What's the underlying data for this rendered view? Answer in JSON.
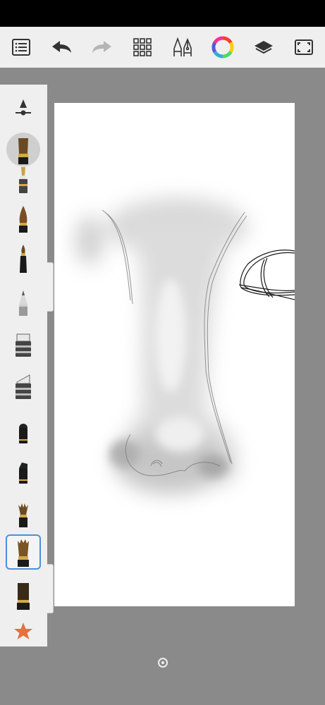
{
  "app": {
    "name": ""
  },
  "toolbar": {
    "items": [
      {
        "name": "list-icon"
      },
      {
        "name": "undo-icon"
      },
      {
        "name": "redo-icon",
        "disabled": true
      },
      {
        "name": "grid-icon"
      },
      {
        "name": "pen-tools-icon"
      },
      {
        "name": "color-wheel-icon"
      },
      {
        "name": "layers-icon"
      },
      {
        "name": "fullscreen-icon"
      }
    ]
  },
  "brush_panel": {
    "top_control": "brush-size-slider-icon",
    "brushes": [
      "bristle-brush-recent",
      "ink-pen",
      "round-brush",
      "paint-brush",
      "pencil",
      "marker-wide",
      "marker-chisel",
      "felt-marker",
      "felt-marker-dark",
      "fan-brush",
      "bristle-brush",
      "flat-brush"
    ],
    "selected": "bristle-brush",
    "favorite": "star-icon"
  },
  "colors": {
    "toolbar_bg": "#efefef",
    "canvas_bg": "#8a8a8a",
    "paper": "#ffffff",
    "selection": "#4a90d9",
    "star": "#e8703a"
  }
}
